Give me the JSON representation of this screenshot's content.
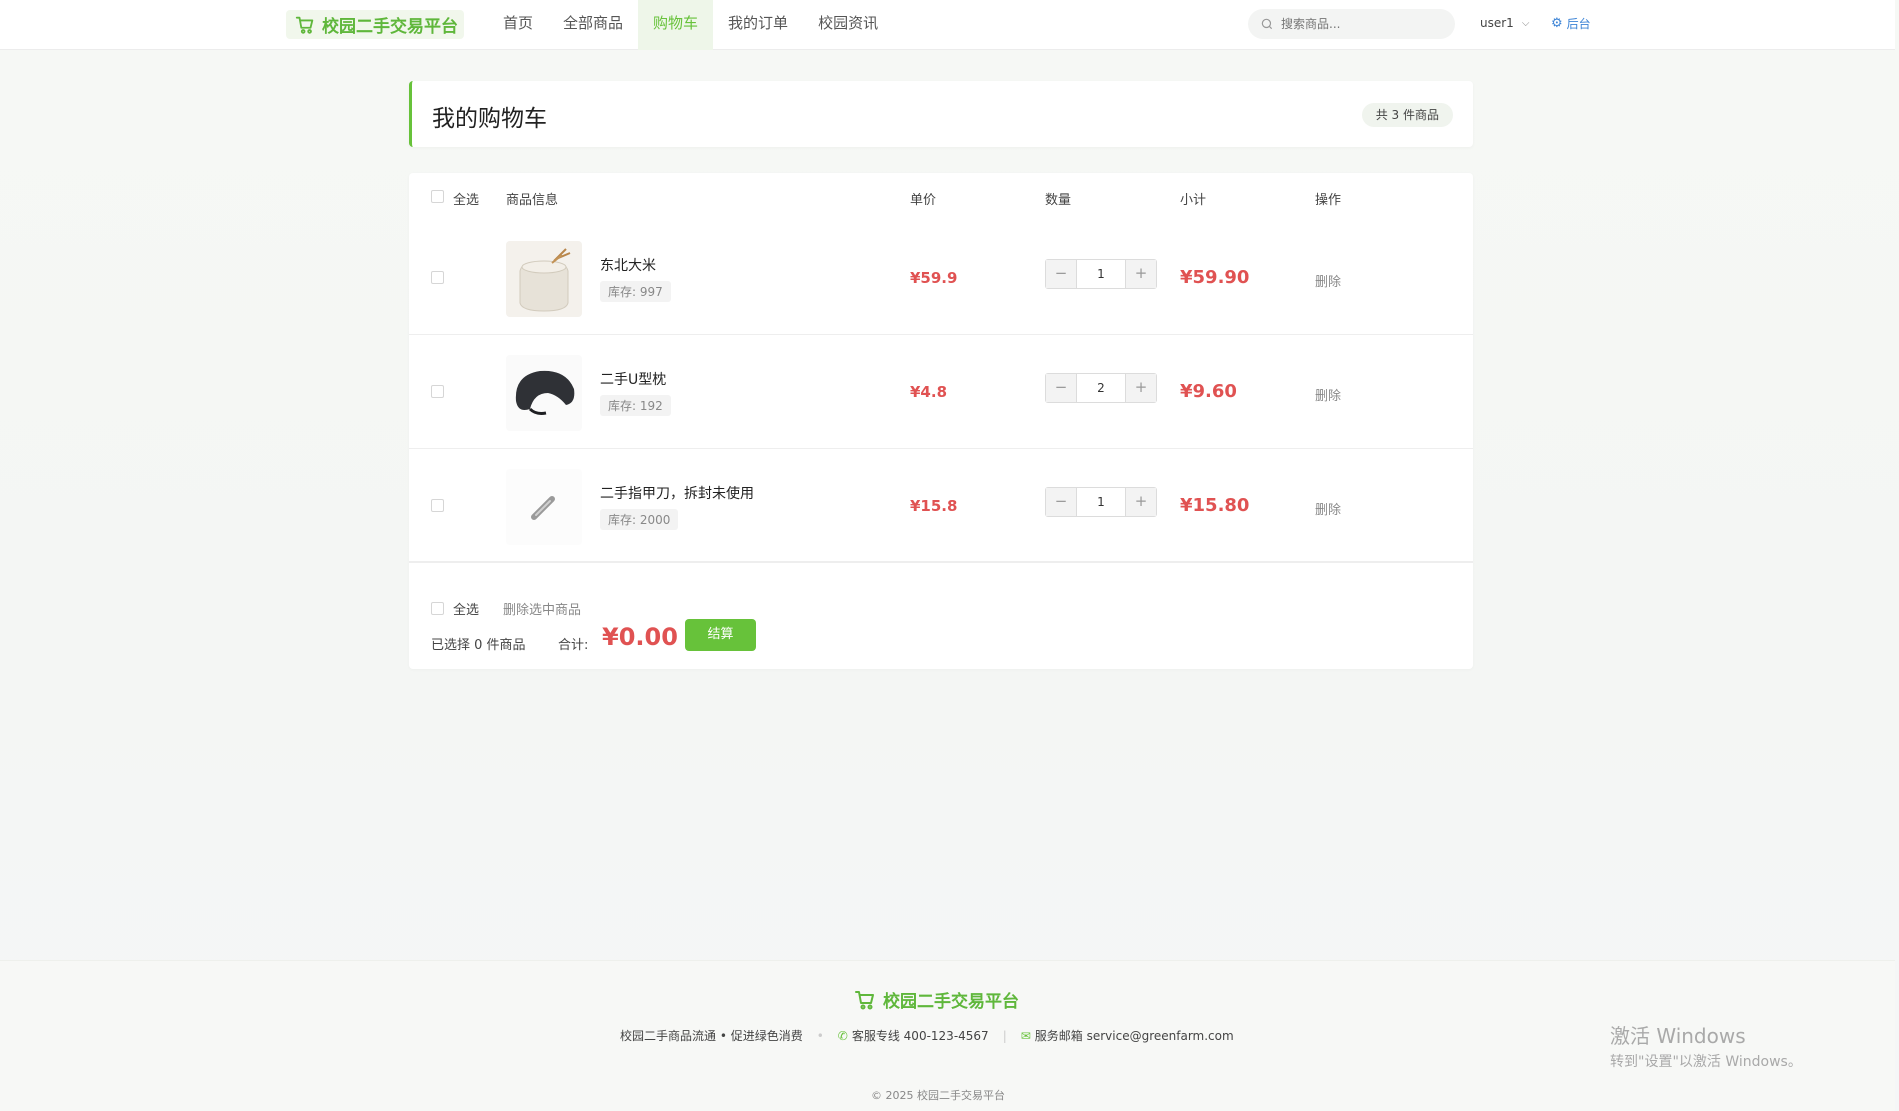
{
  "header": {
    "brand": "校园二手交易平台",
    "nav": [
      "首页",
      "全部商品",
      "购物车",
      "我的订单",
      "校园资讯"
    ],
    "active_nav": "购物车",
    "search_placeholder": "搜索商品...",
    "username": "user1",
    "admin_label": "后台"
  },
  "cart": {
    "title": "我的购物车",
    "count_badge": "共 3 件商品",
    "columns": {
      "select_all": "全选",
      "product": "商品信息",
      "unit_price": "单价",
      "quantity": "数量",
      "subtotal": "小计",
      "action": "操作"
    },
    "items": [
      {
        "name": "东北大米",
        "stock": "库存: 997",
        "price": "¥59.9",
        "qty": "1",
        "subtotal": "¥59.90",
        "delete": "删除"
      },
      {
        "name": "二手U型枕",
        "stock": "库存: 192",
        "price": "¥4.8",
        "qty": "2",
        "subtotal": "¥9.60",
        "delete": "删除"
      },
      {
        "name": "二手指甲刀，拆封未使用",
        "stock": "库存: 2000",
        "price": "¥15.8",
        "qty": "1",
        "subtotal": "¥15.80",
        "delete": "删除"
      }
    ],
    "footer": {
      "select_all": "全选",
      "delete_selected": "删除选中商品",
      "selected_text": "已选择 0 件商品",
      "total_label": "合计:",
      "total": "¥0.00",
      "checkout": "结算"
    }
  },
  "site_footer": {
    "brand": "校园二手交易平台",
    "slogan": "校园二手商品流通 • 促进绿色消费",
    "phone": "客服专线 400-123-4567",
    "email": "服务邮箱 service@greenfarm.com",
    "copyright": "© 2025 校园二手交易平台"
  },
  "watermark": {
    "line1": "激活 Windows",
    "line2": "转到\"设置\"以激活 Windows。"
  },
  "colors": {
    "accent": "#67c23a",
    "price": "#e05252",
    "link": "#3d84d6"
  }
}
